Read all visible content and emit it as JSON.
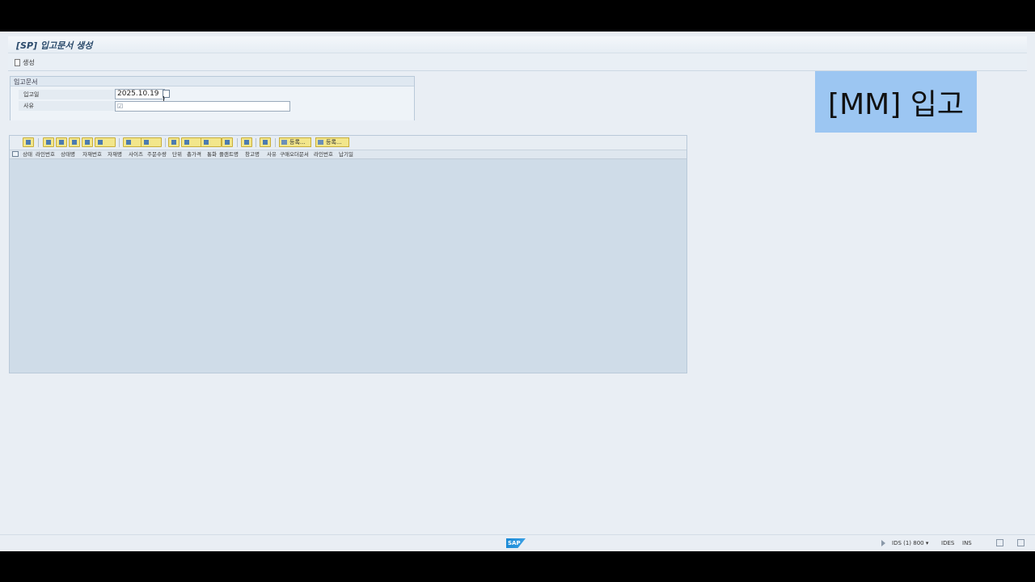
{
  "window": {
    "title": "[SP] 입고문서 생성"
  },
  "toolbar": {
    "create_label": "생성"
  },
  "header_group": {
    "title": "입고문서",
    "fields": [
      {
        "label": "입고일",
        "value": "2025.10.19"
      },
      {
        "label": "사유",
        "value": ""
      }
    ]
  },
  "alv_toolbar": {
    "button1_label": "등록...",
    "button2_label": "등록..."
  },
  "alv_columns": [
    "상태",
    "라인번호",
    "상태명",
    "자재번호",
    "자재명",
    "사이즈",
    "주문수량",
    "단위",
    "총가격",
    "통화",
    "플랜트명",
    "창고명",
    "사유",
    "구매오더문서",
    "라인번호",
    "납기일"
  ],
  "overlay": {
    "text": "[MM] 입고"
  },
  "status": {
    "system": "IDS (1) 800",
    "server": "IDES",
    "mode": "INS"
  },
  "sap_logo": "SAP"
}
